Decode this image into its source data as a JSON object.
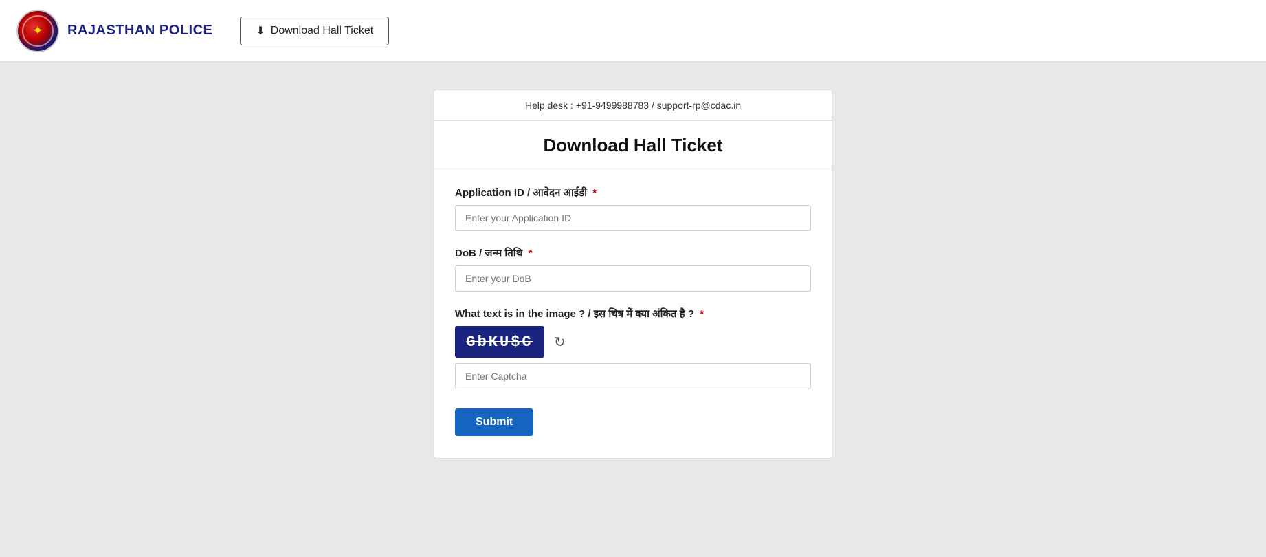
{
  "header": {
    "org_name": "RAJASTHAN POLICE",
    "nav_button_label": "Download Hall Ticket",
    "download_icon": "↓"
  },
  "form_card": {
    "helpdesk_text": "Help desk : +91-9499988783 / support-rp@cdac.in",
    "card_title": "Download Hall Ticket",
    "fields": {
      "application_id": {
        "label": "Application ID / आवेदन आईडी",
        "placeholder": "Enter your Application ID",
        "required": true
      },
      "dob": {
        "label": "DoB / जन्म तिथि",
        "placeholder": "Enter your DoB",
        "required": true
      },
      "captcha_question_label": "What text is in the image ? / इस चित्र में क्या अंकित है ?",
      "captcha_required": true,
      "captcha_value": "GbKU$C",
      "captcha_placeholder": "Enter Captcha",
      "refresh_icon": "↻"
    },
    "submit_label": "Submit"
  }
}
